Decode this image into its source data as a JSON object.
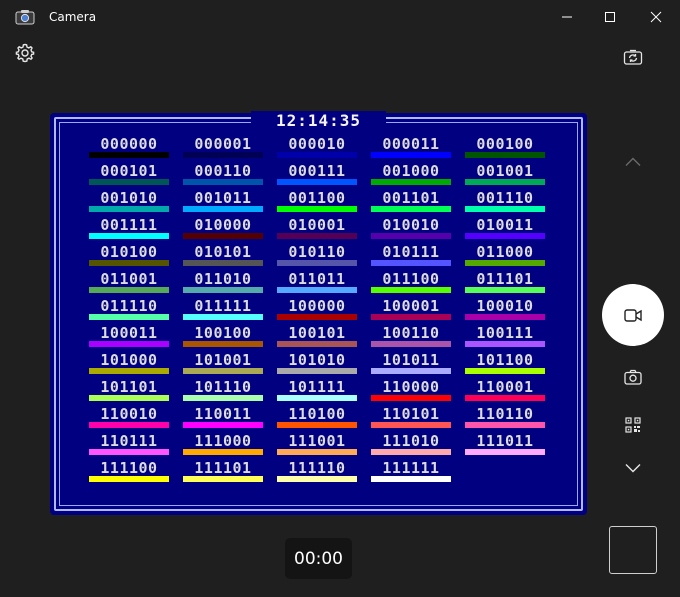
{
  "window": {
    "title": "Camera"
  },
  "preview": {
    "clock": "12:14:35",
    "cells": [
      {
        "label": "000000",
        "color": "#000000"
      },
      {
        "label": "000001",
        "color": "#000055"
      },
      {
        "label": "000010",
        "color": "#0000aa"
      },
      {
        "label": "000011",
        "color": "#0000ff"
      },
      {
        "label": "000100",
        "color": "#005500"
      },
      {
        "label": "000101",
        "color": "#005555"
      },
      {
        "label": "000110",
        "color": "#0055aa"
      },
      {
        "label": "000111",
        "color": "#0055ff"
      },
      {
        "label": "001000",
        "color": "#00aa00"
      },
      {
        "label": "001001",
        "color": "#00aa55"
      },
      {
        "label": "001010",
        "color": "#00aaaa"
      },
      {
        "label": "001011",
        "color": "#00aaff"
      },
      {
        "label": "001100",
        "color": "#00ff00"
      },
      {
        "label": "001101",
        "color": "#00ff55"
      },
      {
        "label": "001110",
        "color": "#00ffaa"
      },
      {
        "label": "001111",
        "color": "#00ffff"
      },
      {
        "label": "010000",
        "color": "#550000"
      },
      {
        "label": "010001",
        "color": "#550055"
      },
      {
        "label": "010010",
        "color": "#5500aa"
      },
      {
        "label": "010011",
        "color": "#5500ff"
      },
      {
        "label": "010100",
        "color": "#555500"
      },
      {
        "label": "010101",
        "color": "#555555"
      },
      {
        "label": "010110",
        "color": "#5555aa"
      },
      {
        "label": "010111",
        "color": "#5555ff"
      },
      {
        "label": "011000",
        "color": "#55aa00"
      },
      {
        "label": "011001",
        "color": "#55aa55"
      },
      {
        "label": "011010",
        "color": "#55aaaa"
      },
      {
        "label": "011011",
        "color": "#55aaff"
      },
      {
        "label": "011100",
        "color": "#55ff00"
      },
      {
        "label": "011101",
        "color": "#55ff55"
      },
      {
        "label": "011110",
        "color": "#55ffaa"
      },
      {
        "label": "011111",
        "color": "#55ffff"
      },
      {
        "label": "100000",
        "color": "#aa0000"
      },
      {
        "label": "100001",
        "color": "#aa0055"
      },
      {
        "label": "100010",
        "color": "#aa00aa"
      },
      {
        "label": "100011",
        "color": "#aa00ff"
      },
      {
        "label": "100100",
        "color": "#aa5500"
      },
      {
        "label": "100101",
        "color": "#aa5555"
      },
      {
        "label": "100110",
        "color": "#aa55aa"
      },
      {
        "label": "100111",
        "color": "#aa55ff"
      },
      {
        "label": "101000",
        "color": "#aaaa00"
      },
      {
        "label": "101001",
        "color": "#aaaa55"
      },
      {
        "label": "101010",
        "color": "#aaaaaa"
      },
      {
        "label": "101011",
        "color": "#aaaaff"
      },
      {
        "label": "101100",
        "color": "#aaff00"
      },
      {
        "label": "101101",
        "color": "#aaff55"
      },
      {
        "label": "101110",
        "color": "#aaffaa"
      },
      {
        "label": "101111",
        "color": "#aaffff"
      },
      {
        "label": "110000",
        "color": "#ff0000"
      },
      {
        "label": "110001",
        "color": "#ff0055"
      },
      {
        "label": "110010",
        "color": "#ff00aa"
      },
      {
        "label": "110011",
        "color": "#ff00ff"
      },
      {
        "label": "110100",
        "color": "#ff5500"
      },
      {
        "label": "110101",
        "color": "#ff5555"
      },
      {
        "label": "110110",
        "color": "#ff55aa"
      },
      {
        "label": "110111",
        "color": "#ff55ff"
      },
      {
        "label": "111000",
        "color": "#ffaa00"
      },
      {
        "label": "111001",
        "color": "#ffaa55"
      },
      {
        "label": "111010",
        "color": "#ffaaaa"
      },
      {
        "label": "111011",
        "color": "#ffaaff"
      },
      {
        "label": "111100",
        "color": "#ffff00"
      },
      {
        "label": "111101",
        "color": "#ffff55"
      },
      {
        "label": "111110",
        "color": "#ffffaa"
      },
      {
        "label": "111111",
        "color": "#ffffff"
      }
    ]
  },
  "timer": "00:00",
  "icons": {
    "app": "camera-app-icon",
    "settings": "gear-icon",
    "switch_camera": "switch-camera-icon",
    "up": "chevron-up-icon",
    "video": "video-camera-icon",
    "photo": "photo-camera-icon",
    "qr": "qr-code-icon",
    "down": "chevron-down-icon"
  },
  "colors": {
    "background": "#1f1f1f",
    "preview_bg": "#000080"
  }
}
